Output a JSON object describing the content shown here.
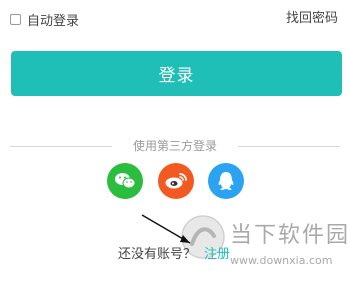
{
  "top_row": {
    "remember_label": "自动登录",
    "forgot_label": "找回密码"
  },
  "login_button": {
    "label": "登录",
    "color": "#1fbfb8"
  },
  "third_party": {
    "label": "使用第三方登录",
    "providers": [
      {
        "name": "wechat-icon",
        "color": "#2bbd3e"
      },
      {
        "name": "weibo-icon",
        "color": "#f25a22"
      },
      {
        "name": "qq-icon",
        "color": "#2aa3f2"
      }
    ]
  },
  "footer": {
    "no_account_text": "还没有账号？",
    "register_link": "注册"
  },
  "watermark": {
    "brand": "当下软件园",
    "url": "www.downxia.com"
  }
}
